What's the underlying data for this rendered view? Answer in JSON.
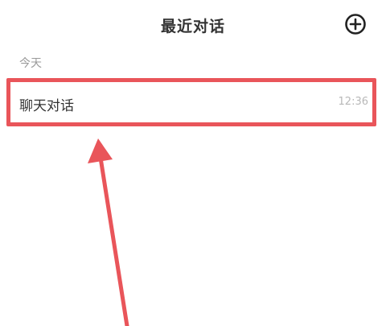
{
  "header": {
    "title": "最近对话",
    "add_icon": "add-circle-icon"
  },
  "sections": [
    {
      "label": "今天",
      "items": [
        {
          "name": "聊天对话",
          "time": "12:36"
        }
      ]
    }
  ],
  "annotation": {
    "highlight_color": "#e9555a",
    "arrow_color": "#e9555a"
  }
}
